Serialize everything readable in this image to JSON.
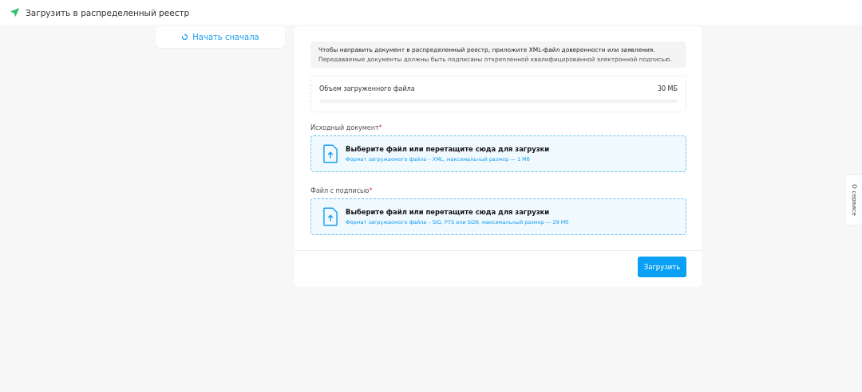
{
  "header": {
    "title": "Загрузить в распределенный реестр"
  },
  "restart_button": {
    "label": "Начать сначала"
  },
  "notice": {
    "lines": [
      "Чтобы направить документ в распределенный реестр, приложите XML-файл доверенности или заявления.",
      "Передаваемые документы должны быть подписаны открепленной квалифицированной электронной подписью."
    ]
  },
  "upload_size": {
    "label": "Объем загруженного файла",
    "value": "30 МБ",
    "level": 0
  },
  "fields": [
    {
      "label": "Исходный документ",
      "required_mark": "*",
      "prompt": "Выберите файл или перетащите сюда для загрузки",
      "hint": "Формат загружаемого файла – XML, максимальный размер — 1 Мб"
    },
    {
      "label": "Файл с подписью",
      "required_mark": "*",
      "prompt": "Выберите файл или перетащите сюда для загрузки",
      "hint": "Формат загружаемого файла – SIG, P7S или SGN, максимальный размер — 29 Мб"
    }
  ],
  "submit_button": {
    "label": "Загрузить"
  },
  "side_tab": {
    "label": "О сервисе"
  }
}
